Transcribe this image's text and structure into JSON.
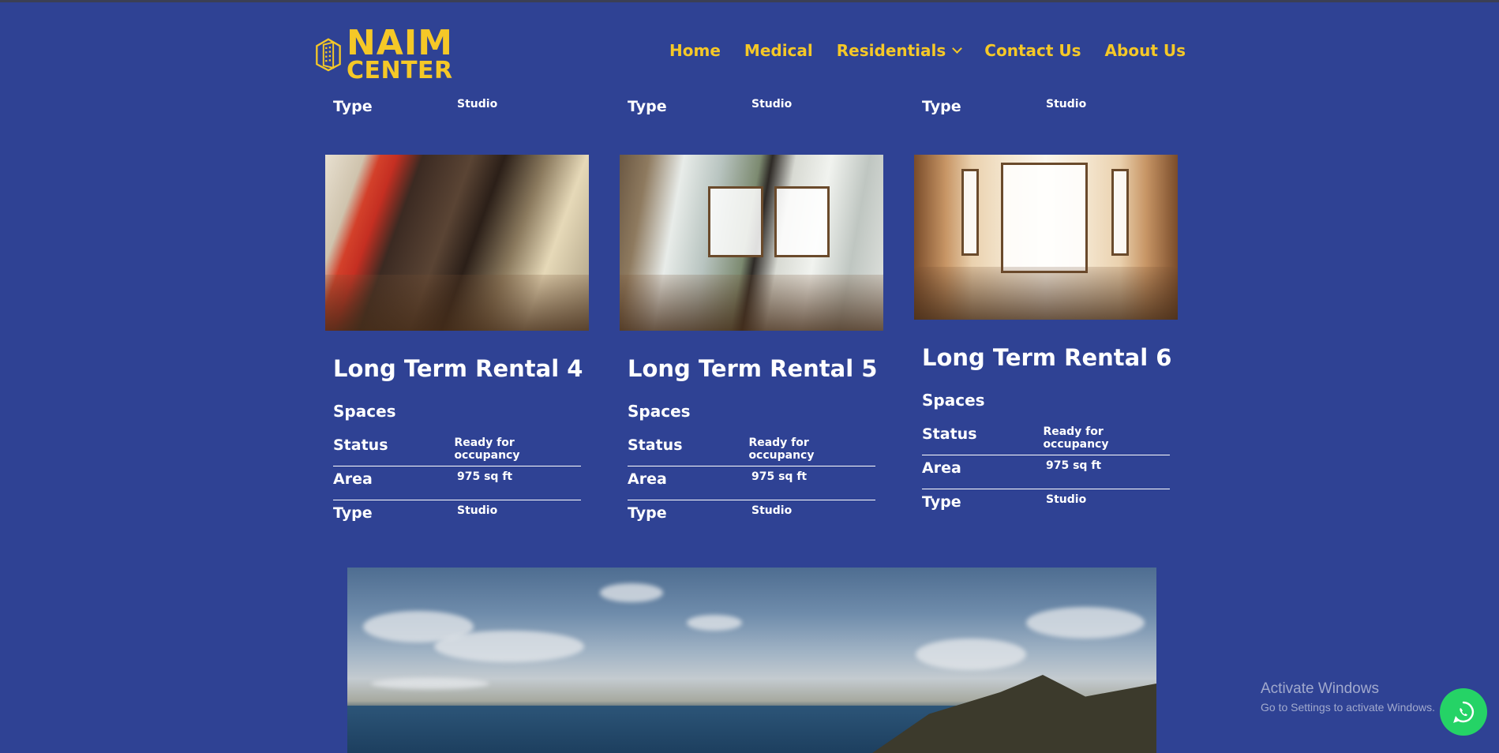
{
  "brand": {
    "line1": "NAIM",
    "line2": "CENTER"
  },
  "nav": {
    "home": "Home",
    "medical": "Medical",
    "residentials": "Residentials",
    "contact": "Contact Us",
    "about": "About Us"
  },
  "previous_row": [
    {
      "label": "Type",
      "value": "Studio"
    },
    {
      "label": "Type",
      "value": "Studio"
    },
    {
      "label": "Type",
      "value": "Studio"
    }
  ],
  "listings": [
    {
      "title": "Long Term Rental 4",
      "section": "Spaces",
      "rows": [
        {
          "label": "Status",
          "value": "Ready for occupancy"
        },
        {
          "label": "Area",
          "value": "975 sq ft"
        },
        {
          "label": "Type",
          "value": "Studio"
        }
      ]
    },
    {
      "title": "Long Term Rental 5",
      "section": "Spaces",
      "rows": [
        {
          "label": "Status",
          "value": "Ready for occupancy"
        },
        {
          "label": "Area",
          "value": "975 sq ft"
        },
        {
          "label": "Type",
          "value": "Studio"
        }
      ]
    },
    {
      "title": "Long Term Rental 6",
      "section": "Spaces",
      "rows": [
        {
          "label": "Status",
          "value": "Ready for occupancy"
        },
        {
          "label": "Area",
          "value": "975 sq ft"
        },
        {
          "label": "Type",
          "value": "Studio"
        }
      ]
    }
  ],
  "windows_watermark": {
    "title": "Activate Windows",
    "subtitle": "Go to Settings to activate Windows."
  },
  "colors": {
    "background": "#2f4294",
    "accent": "#f5c827",
    "whatsapp": "#25d366"
  },
  "icons": {
    "logo": "building-logo-icon",
    "dropdown": "chevron-down-icon",
    "chat": "whatsapp-icon"
  }
}
